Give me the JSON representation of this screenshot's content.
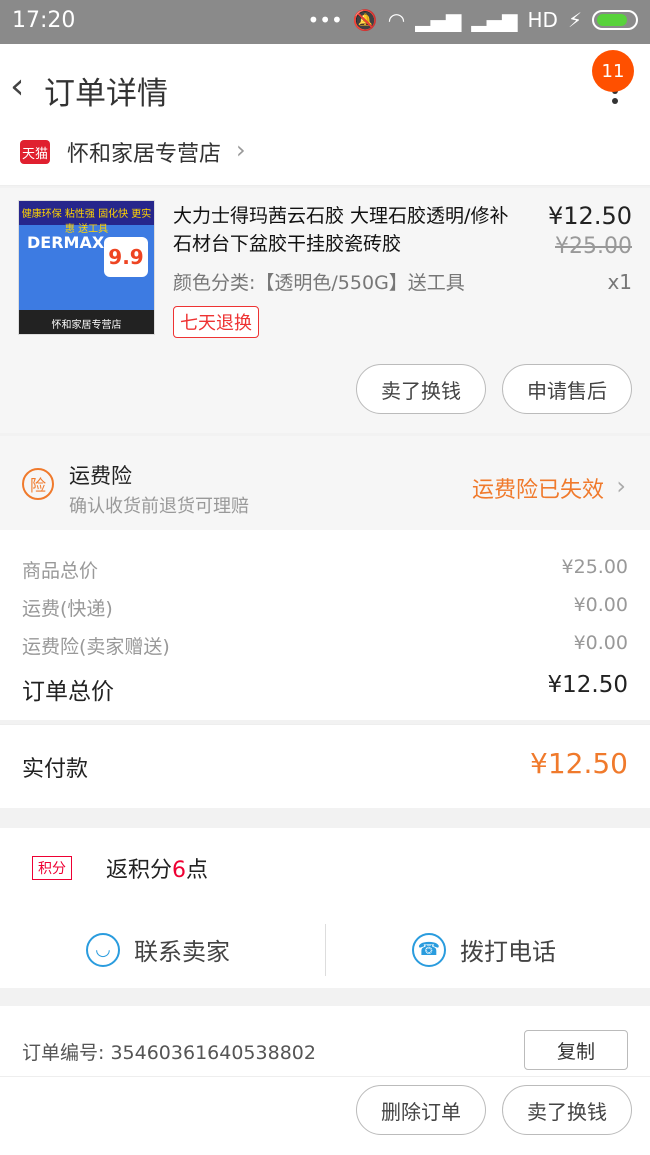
{
  "status_bar": {
    "time": "17:20",
    "network": "HD",
    "icons": [
      "notification-dots",
      "vibrate-off-icon",
      "wifi-icon",
      "signal-icon",
      "signal-icon",
      "battery-icon"
    ]
  },
  "header": {
    "title": "订单详情",
    "badge_count": "11"
  },
  "shop": {
    "name": "怀和家居专营店",
    "platform_badge": "天猫"
  },
  "product": {
    "image_text": {
      "brand": "DERMAX",
      "price_tag": "9.9",
      "top_banner": "健康环保 粘性强 固化快 更实惠 送工具",
      "bottom_label": "怀和家居专营店"
    },
    "title": "大力士得玛茜云石胶 大理石胶透明/修补石材台下盆胶干挂胶瓷砖胶",
    "variant": "颜色分类:【透明色/550G】送工具",
    "return_badge": "七天退换",
    "price": "¥12.50",
    "original_price": "¥25.00",
    "quantity": "x1",
    "buttons": {
      "sell": "卖了换钱",
      "after_sale": "申请售后"
    }
  },
  "insurance": {
    "icon_text": "险",
    "title": "运费险",
    "subtitle": "确认收货前退货可理赔",
    "status": "运费险已失效"
  },
  "price_summary": {
    "rows": [
      {
        "label": "商品总价",
        "value": "¥25.00"
      },
      {
        "label": "运费(快递)",
        "value": "¥0.00"
      },
      {
        "label": "运费险(卖家赠送)",
        "value": "¥0.00"
      }
    ],
    "total_label": "订单总价",
    "total_value": "¥12.50"
  },
  "payment": {
    "label": "实付款",
    "amount": "¥12.50"
  },
  "points": {
    "badge": "积分",
    "text_prefix": "返积分",
    "number": "6",
    "text_suffix": "点"
  },
  "contacts": {
    "seller": "联系卖家",
    "phone": "拨打电话"
  },
  "order": {
    "label": "订单编号:",
    "number": "35460361640538802",
    "copy_button": "复制"
  },
  "footer_buttons": {
    "delete": "删除订单",
    "sell": "卖了换钱"
  },
  "colors": {
    "accent": "#f07a2c",
    "tmall_red": "#e0202f",
    "icon_blue": "#2a9cde",
    "badge_orange": "#ff5000"
  }
}
